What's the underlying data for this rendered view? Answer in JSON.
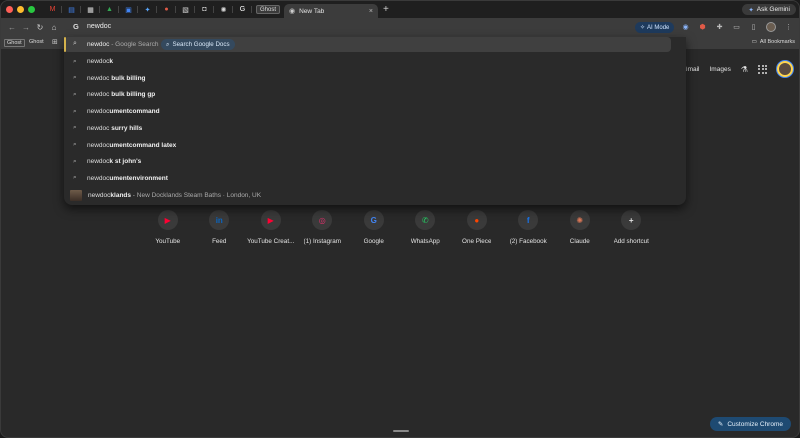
{
  "tabs": {
    "ghost_chip": "Ghost",
    "active_title": "New Tab",
    "new_tab": "+",
    "ask_gemini": "Ask Gemini",
    "pinned": [
      {
        "icon": "gmail-icon",
        "glyph": "M",
        "color": "#ea4335"
      },
      {
        "icon": "docs-icon",
        "glyph": "▤",
        "color": "#4285f4"
      },
      {
        "icon": "notion-icon",
        "glyph": "▦",
        "color": "#dddddd"
      },
      {
        "icon": "drive-icon",
        "glyph": "▲",
        "color": "#34a853"
      },
      {
        "icon": "calendar-icon",
        "glyph": "▣",
        "color": "#4285f4"
      },
      {
        "icon": "sparkle-icon",
        "glyph": "✦",
        "color": "#5aa9ff"
      },
      {
        "icon": "red-app-icon",
        "glyph": "●",
        "color": "#e05a47"
      },
      {
        "icon": "box-icon",
        "glyph": "▧",
        "color": "#dddddd"
      },
      {
        "icon": "dark-app-icon",
        "glyph": "◘",
        "color": "#cccccc"
      },
      {
        "icon": "openai-icon",
        "glyph": "✺",
        "color": "#dddddd"
      },
      {
        "icon": "google-icon",
        "glyph": "G",
        "color": "#ffffff"
      }
    ]
  },
  "toolbar": {
    "omnibox_text": "newdoc",
    "ai_mode": "AI Mode"
  },
  "bookmarks": {
    "ghost_1": "Ghost",
    "ghost_2": "Ghost",
    "all_bookmarks": "All Bookmarks"
  },
  "dropdown": {
    "selected": {
      "typed": "newdoc",
      "suffix": " - Google Search",
      "chip": "Search Google Docs"
    },
    "suggestions": [
      {
        "typed": "newdoc",
        "bold": "k",
        "extra": ""
      },
      {
        "typed": "newdoc",
        "bold": " bulk billing",
        "extra": ""
      },
      {
        "typed": "newdoc",
        "bold": " bulk billing gp",
        "extra": ""
      },
      {
        "typed": "newdoc",
        "bold": "umentcommand",
        "extra": ""
      },
      {
        "typed": "newdoc",
        "bold": " surry hills",
        "extra": ""
      },
      {
        "typed": "newdoc",
        "bold": "umentcommand latex",
        "extra": ""
      },
      {
        "typed": "newdoc",
        "bold": "k st john's",
        "extra": ""
      },
      {
        "typed": "newdoc",
        "bold": "umentenvironment",
        "extra": ""
      },
      {
        "typed": "newdoc",
        "bold": "klands",
        "extra": " - New Docklands Steam Baths · London, UK"
      }
    ]
  },
  "ntp": {
    "gmail": "Gmail",
    "images": "Images",
    "shortcuts": [
      {
        "label": "YouTube",
        "glyph": "▶",
        "color": "#ff0033"
      },
      {
        "label": "Feed",
        "glyph": "in",
        "color": "#0a66c2"
      },
      {
        "label": "YouTube Creat...",
        "glyph": "▶",
        "color": "#ff0033"
      },
      {
        "label": "(1) Instagram",
        "glyph": "◎",
        "color": "#e1306c"
      },
      {
        "label": "Google",
        "glyph": "G",
        "color": "#4285f4"
      },
      {
        "label": "WhatsApp",
        "glyph": "✆",
        "color": "#25d366"
      },
      {
        "label": "One Piece",
        "glyph": "●",
        "color": "#ff4500"
      },
      {
        "label": "(2) Facebook",
        "glyph": "f",
        "color": "#1877f2"
      },
      {
        "label": "Claude",
        "glyph": "✺",
        "color": "#d97757"
      },
      {
        "label": "Add shortcut",
        "glyph": "+",
        "color": "#e3e3e3"
      }
    ],
    "customize": "Customize Chrome"
  }
}
